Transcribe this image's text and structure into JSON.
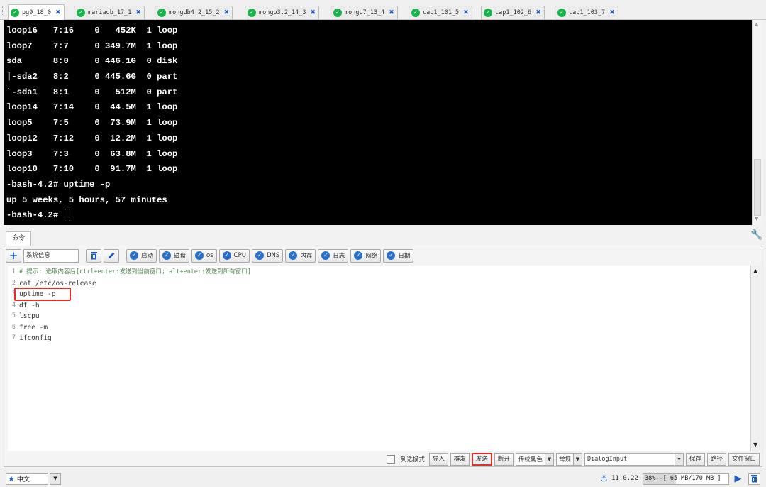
{
  "tabs": [
    {
      "label": "pg9_18_0",
      "active": true
    },
    {
      "label": "mariadb_17_1",
      "active": false
    },
    {
      "label": "mongdb4.2_15_2",
      "active": false
    },
    {
      "label": "mongo3.2_14_3",
      "active": false
    },
    {
      "label": "mongo7_13_4",
      "active": false
    },
    {
      "label": "cap1_101_5",
      "active": false
    },
    {
      "label": "cap1_102_6",
      "active": false
    },
    {
      "label": "cap1_103_7",
      "active": false
    }
  ],
  "terminal": {
    "lines": [
      "loop16   7:16    0   452K  1 loop",
      "loop7    7:7     0 349.7M  1 loop",
      "sda      8:0     0 446.1G  0 disk",
      "|-sda2   8:2     0 445.6G  0 part",
      "`-sda1   8:1     0   512M  0 part",
      "loop14   7:14    0  44.5M  1 loop",
      "loop5    7:5     0  73.9M  1 loop",
      "loop12   7:12    0  12.2M  1 loop",
      "loop3    7:3     0  63.8M  1 loop",
      "loop10   7:10    0  91.7M  1 loop",
      "-bash-4.2# uptime -p",
      "up 5 weeks, 5 hours, 57 minutes"
    ],
    "prompt": "-bash-4.2# "
  },
  "command_panel": {
    "tab_label": "命令",
    "toolbar": {
      "system_info": "系统信息",
      "buttons": [
        "启动",
        "磁盘",
        "os",
        "CPU",
        "DNS",
        "内存",
        "日志",
        "网络",
        "日期"
      ]
    },
    "editor": {
      "lines": [
        {
          "num": "1",
          "text": "# 提示: 选取内容后[ctrl+enter:发送到当前窗口; alt+enter:发送到所有窗口]"
        },
        {
          "num": "2",
          "text": "cat /etc/os-release"
        },
        {
          "num": "3",
          "text": "uptime -p"
        },
        {
          "num": "4",
          "text": "df -h"
        },
        {
          "num": "5",
          "text": "lscpu"
        },
        {
          "num": "6",
          "text": "free -m"
        },
        {
          "num": "7",
          "text": "ifconfig"
        }
      ]
    },
    "bottom": {
      "column_mode": "列选模式",
      "import": "导入",
      "group_send": "群发",
      "send": "发送",
      "disconnect": "断开",
      "theme": "传统黑色",
      "style": "常规",
      "font": "DialogInput",
      "save": "保存",
      "path": "路径",
      "file_window": "文件窗口"
    }
  },
  "statusbar": {
    "language": "中文",
    "version": "11.0.22",
    "memory": "38%--[ 65 MB/170 MB ]",
    "memory_fraction": 0.38
  },
  "colors": {
    "tab_ok": "#19b44a",
    "accent": "#2a6fc9",
    "highlight": "#e0302a"
  }
}
